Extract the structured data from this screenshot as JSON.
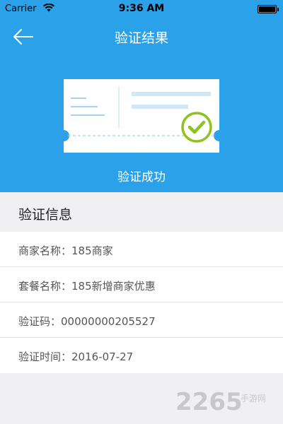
{
  "status_bar": {
    "carrier": "Carrier",
    "time": "9:36 AM",
    "wifi_icon": "wifi-icon",
    "battery_icon": "battery-icon"
  },
  "nav": {
    "title": "验证结果",
    "back_icon": "back-arrow-icon"
  },
  "hero": {
    "status_text": "验证成功",
    "ticket_icon": "ticket-icon",
    "check_icon": "check-circle-icon"
  },
  "info": {
    "header": "验证信息",
    "rows": [
      {
        "text": "商家名称：185商家"
      },
      {
        "text": "套餐名称：185新增商家优惠"
      },
      {
        "text": "验证码：00000000205527"
      },
      {
        "text": "验证时间：2016-07-27"
      }
    ]
  },
  "watermark": {
    "text": "2265",
    "sub_text": "手游网"
  },
  "colors": {
    "primary": "#2aa1e8",
    "check": "#8dc21f",
    "background": "#f0f0f2"
  }
}
